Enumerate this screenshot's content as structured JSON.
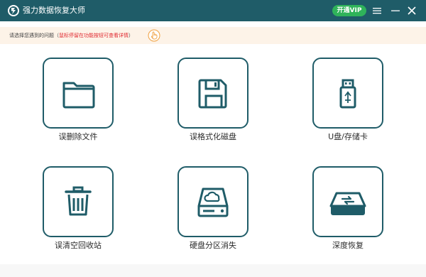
{
  "app": {
    "title": "强力数据恢复大师",
    "logo_icon": "app-logo-icon",
    "vip_label": "开通VIP",
    "colors": {
      "titlebar": "#1f5c68",
      "vip": "#2fb35a",
      "hint_bg": "#fdf3e8",
      "hint_highlight": "#e0282f"
    }
  },
  "window_controls": {
    "menu_icon": "menu-icon",
    "minimize_icon": "minimize-icon",
    "close_icon": "close-icon"
  },
  "hint": {
    "prefix": "请选择您遇到的问题（",
    "highlight": "鼠标停留在功能按钮可查看详情",
    "suffix": "）",
    "icon": "hand-pointer-icon"
  },
  "tiles": [
    {
      "label": "误删除文件",
      "icon": "folder-icon"
    },
    {
      "label": "误格式化磁盘",
      "icon": "floppy-disk-icon"
    },
    {
      "label": "U盘/存储卡",
      "icon": "usb-drive-icon"
    },
    {
      "label": "误清空回收站",
      "icon": "trash-bin-icon"
    },
    {
      "label": "硬盘分区消失",
      "icon": "hard-drive-cloud-icon"
    },
    {
      "label": "深度恢复",
      "icon": "deep-recovery-icon"
    }
  ]
}
